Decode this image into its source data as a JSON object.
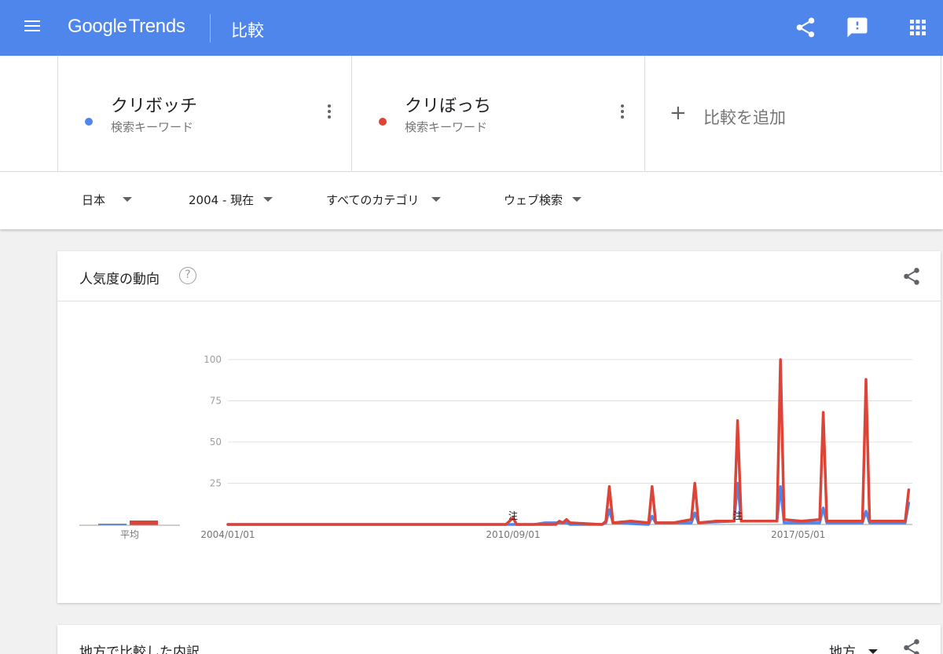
{
  "header": {
    "logo_google": "Google",
    "logo_trends": "Trends",
    "page_title": "比較"
  },
  "terms": [
    {
      "name": "クリボッチ",
      "type": "検索キーワード",
      "color": "#4f86ec"
    },
    {
      "name": "クリぼっち",
      "type": "検索キーワード",
      "color": "#db4437"
    }
  ],
  "add_compare": {
    "label": "比較を追加"
  },
  "filters": {
    "region": "日本",
    "period": "2004 - 現在",
    "category": "すべてのカテゴリ",
    "search_type": "ウェブ検索"
  },
  "interest_card": {
    "title": "人気度の動向",
    "help_glyph": "?",
    "avg_label": "平均"
  },
  "chart_data": {
    "type": "line",
    "ylim": [
      0,
      100
    ],
    "yticks": [
      25,
      50,
      75,
      100
    ],
    "xticks": [
      "2004/01/01",
      "2010/09/01",
      "2017/05/01"
    ],
    "annotations": [
      {
        "label": "注",
        "x": "2010/09/01"
      },
      {
        "label": "注",
        "x": "2015/12/01"
      }
    ],
    "averages": [
      1,
      3
    ],
    "series": [
      {
        "name": "クリボッチ",
        "color": "#4f86ec",
        "points": [
          [
            "2004/01/01",
            0
          ],
          [
            "2010/09/01",
            0
          ],
          [
            "2011/03/01",
            0
          ],
          [
            "2011/06/01",
            1
          ],
          [
            "2011/11/01",
            1
          ],
          [
            "2011/12/01",
            1
          ],
          [
            "2012/01/01",
            0
          ],
          [
            "2012/10/01",
            0
          ],
          [
            "2012/11/01",
            1
          ],
          [
            "2012/12/01",
            9
          ],
          [
            "2013/01/01",
            1
          ],
          [
            "2013/11/01",
            0
          ],
          [
            "2013/12/01",
            5
          ],
          [
            "2014/01/01",
            1
          ],
          [
            "2014/11/01",
            1
          ],
          [
            "2014/12/01",
            7
          ],
          [
            "2015/01/01",
            1
          ],
          [
            "2015/11/01",
            2
          ],
          [
            "2015/12/01",
            25
          ],
          [
            "2016/01/01",
            2
          ],
          [
            "2016/11/01",
            2
          ],
          [
            "2016/12/01",
            23
          ],
          [
            "2017/01/01",
            1
          ],
          [
            "2017/11/01",
            1
          ],
          [
            "2017/12/01",
            10
          ],
          [
            "2018/01/01",
            1
          ],
          [
            "2018/11/01",
            1
          ],
          [
            "2018/12/01",
            8
          ],
          [
            "2019/01/01",
            1
          ],
          [
            "2019/11/01",
            1
          ],
          [
            "2019/12/01",
            13
          ]
        ]
      },
      {
        "name": "クリぼっち",
        "color": "#db4437",
        "points": [
          [
            "2004/01/01",
            0
          ],
          [
            "2010/07/01",
            0
          ],
          [
            "2010/08/01",
            2
          ],
          [
            "2010/09/01",
            4
          ],
          [
            "2010/10/01",
            0
          ],
          [
            "2011/09/01",
            0
          ],
          [
            "2011/10/01",
            2
          ],
          [
            "2011/11/01",
            1
          ],
          [
            "2011/12/01",
            3
          ],
          [
            "2012/01/01",
            1
          ],
          [
            "2012/10/01",
            0
          ],
          [
            "2012/11/01",
            2
          ],
          [
            "2012/12/01",
            23
          ],
          [
            "2013/01/01",
            1
          ],
          [
            "2013/06/01",
            2
          ],
          [
            "2013/11/01",
            1
          ],
          [
            "2013/12/01",
            23
          ],
          [
            "2014/01/01",
            1
          ],
          [
            "2014/06/01",
            1
          ],
          [
            "2014/11/01",
            3
          ],
          [
            "2014/12/01",
            25
          ],
          [
            "2015/01/01",
            1
          ],
          [
            "2015/06/01",
            2
          ],
          [
            "2015/11/01",
            2
          ],
          [
            "2015/12/01",
            63
          ],
          [
            "2016/01/01",
            2
          ],
          [
            "2016/06/01",
            2
          ],
          [
            "2016/11/01",
            2
          ],
          [
            "2016/12/01",
            100
          ],
          [
            "2017/01/01",
            3
          ],
          [
            "2017/06/01",
            2
          ],
          [
            "2017/11/01",
            3
          ],
          [
            "2017/12/01",
            68
          ],
          [
            "2018/01/01",
            2
          ],
          [
            "2018/06/01",
            2
          ],
          [
            "2018/11/01",
            2
          ],
          [
            "2018/12/01",
            88
          ],
          [
            "2019/01/01",
            2
          ],
          [
            "2019/06/01",
            2
          ],
          [
            "2019/11/01",
            2
          ],
          [
            "2019/12/01",
            21
          ]
        ]
      }
    ]
  },
  "region_card": {
    "title": "地方で比較した内訳",
    "dropdown": "地方"
  },
  "icons": {
    "menu": "menu-icon",
    "share": "share-icon",
    "feedback": "feedback-icon",
    "apps": "apps-grid-icon",
    "more": "more-vert-icon",
    "add": "plus-icon",
    "help": "help-icon"
  }
}
